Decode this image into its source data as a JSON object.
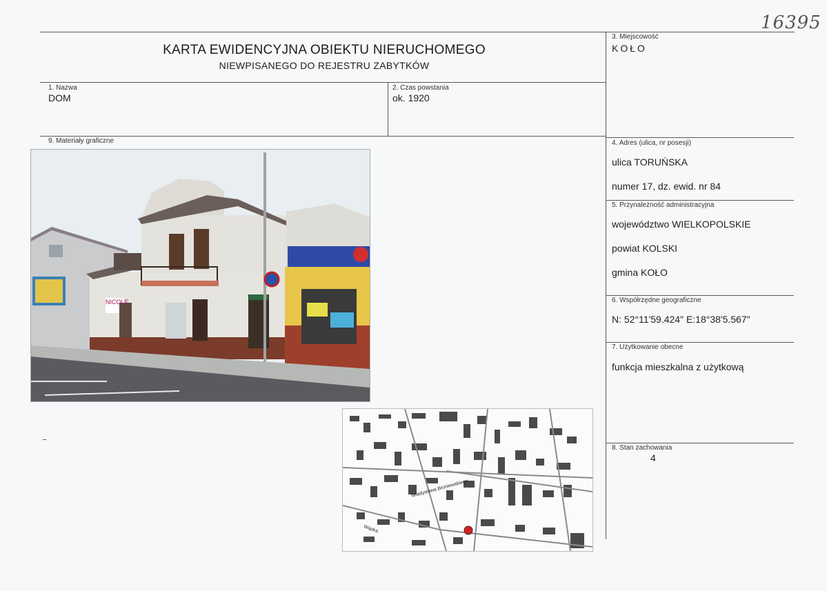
{
  "header": {
    "title": "KARTA EWIDENCYJNA OBIEKTU NIERUCHOMEGO",
    "subtitle": "NIEWPISANEGO DO REJESTRU ZABYTKÓW",
    "handwritten_number": "16395"
  },
  "fields": {
    "miejscowosc": {
      "label": "3. Miejscowość",
      "value": "KOŁO"
    },
    "nazwa": {
      "label": "1. Nazwa",
      "value": "DOM"
    },
    "czas_powstania": {
      "label": "2. Czas powstania",
      "value": "ok. 1920"
    },
    "materialy": {
      "label": "9. Materiały graficzne"
    },
    "adres": {
      "label": "4. Adres (ulica, nr posesji)",
      "street": "ulica  TORUŃSKA",
      "number": "numer 17, dz. ewid. nr 84"
    },
    "przynaleznosc": {
      "label": "5. Przynależność administracyjna",
      "wojewodztwo": "województwo WIELKOPOLSKIE",
      "powiat": "powiat KOLSKI",
      "gmina": "gmina KOŁO"
    },
    "wspolrzedne": {
      "label": "6. Współrzędne geograficzne",
      "value": "N: 52°11'59.424\" E:18°38'5.567\""
    },
    "uzytkowanie": {
      "label": "7. Użytkowanie obecne",
      "value": "funkcja mieszkalna z użytkową"
    },
    "stan": {
      "label": "8. Stan zachowania",
      "value": "4"
    }
  },
  "photo": {
    "shop_sign": "NICOLE"
  },
  "map": {
    "street_labels": [
      "Wladyslawa Broniewskiego",
      "Wąska"
    ]
  },
  "colors": {
    "line": "#5a5a5a",
    "brick": "#7b3b2a",
    "facade": "#e4e2dc",
    "sky": "#e9eef2",
    "shop_yellow": "#e7c64a",
    "map_marker": "#d81f1f"
  }
}
